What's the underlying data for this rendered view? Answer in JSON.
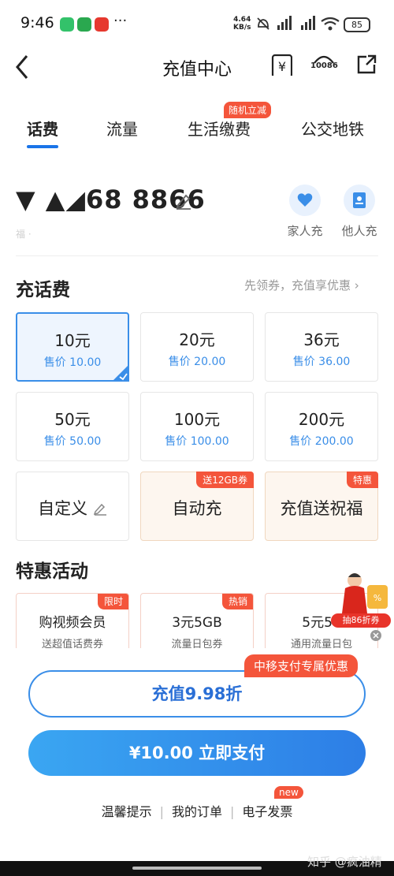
{
  "status_bar": {
    "time": "9:46",
    "speed_top": "4.64",
    "speed_bottom": "KB/s",
    "battery": "85"
  },
  "nav": {
    "title": "充值中心",
    "service_label": "10086"
  },
  "tabs": [
    {
      "label": "话费"
    },
    {
      "label": "流量"
    },
    {
      "label": "生活缴费"
    },
    {
      "label": "公交地铁"
    }
  ],
  "tab_badge": "随机立减",
  "phone": {
    "number": "▼ ▲◢68 8866",
    "sub": "福 ·"
  },
  "quick_actions": [
    {
      "label": "家人充",
      "icon": "family-heart-icon"
    },
    {
      "label": "他人充",
      "icon": "contact-book-icon"
    }
  ],
  "recharge": {
    "title": "充话费",
    "subtitle": "先领券，充值享优惠",
    "cards": [
      {
        "amount": "10元",
        "price": "售价 10.00",
        "selected": true
      },
      {
        "amount": "20元",
        "price": "售价 20.00"
      },
      {
        "amount": "36元",
        "price": "售价 36.00"
      },
      {
        "amount": "50元",
        "price": "售价 50.00"
      },
      {
        "amount": "100元",
        "price": "售价 100.00"
      },
      {
        "amount": "200元",
        "price": "售价 200.00"
      }
    ],
    "custom_label": "自定义",
    "auto_label": "自动充",
    "auto_badge": "送12GB券",
    "blessing_label": "充值送祝福",
    "blessing_badge": "特惠"
  },
  "promotions": {
    "title": "特惠活动",
    "items": [
      {
        "title": "购视频会员",
        "sub": "送超值话费券",
        "badge": "限时"
      },
      {
        "title": "3元5GB",
        "sub": "流量日包券",
        "badge": "热销"
      },
      {
        "title": "5元50",
        "sub": "通用流量日包",
        "badge": ""
      }
    ]
  },
  "float_ad": {
    "label": "抽86折券"
  },
  "bottom": {
    "discount_button": "充值9.98折",
    "discount_badge": "中移支付专属优惠",
    "pay_button": "¥10.00 立即支付",
    "links": [
      "温馨提示",
      "我的订单",
      "电子发票"
    ],
    "new_badge": "new"
  },
  "watermark": "知乎 @疯油精",
  "colors": {
    "accent": "#3a8ee8",
    "badge_red": "#f4553b",
    "pay_gradient_start": "#3aa6f2",
    "pay_gradient_end": "#2d7ee6"
  }
}
